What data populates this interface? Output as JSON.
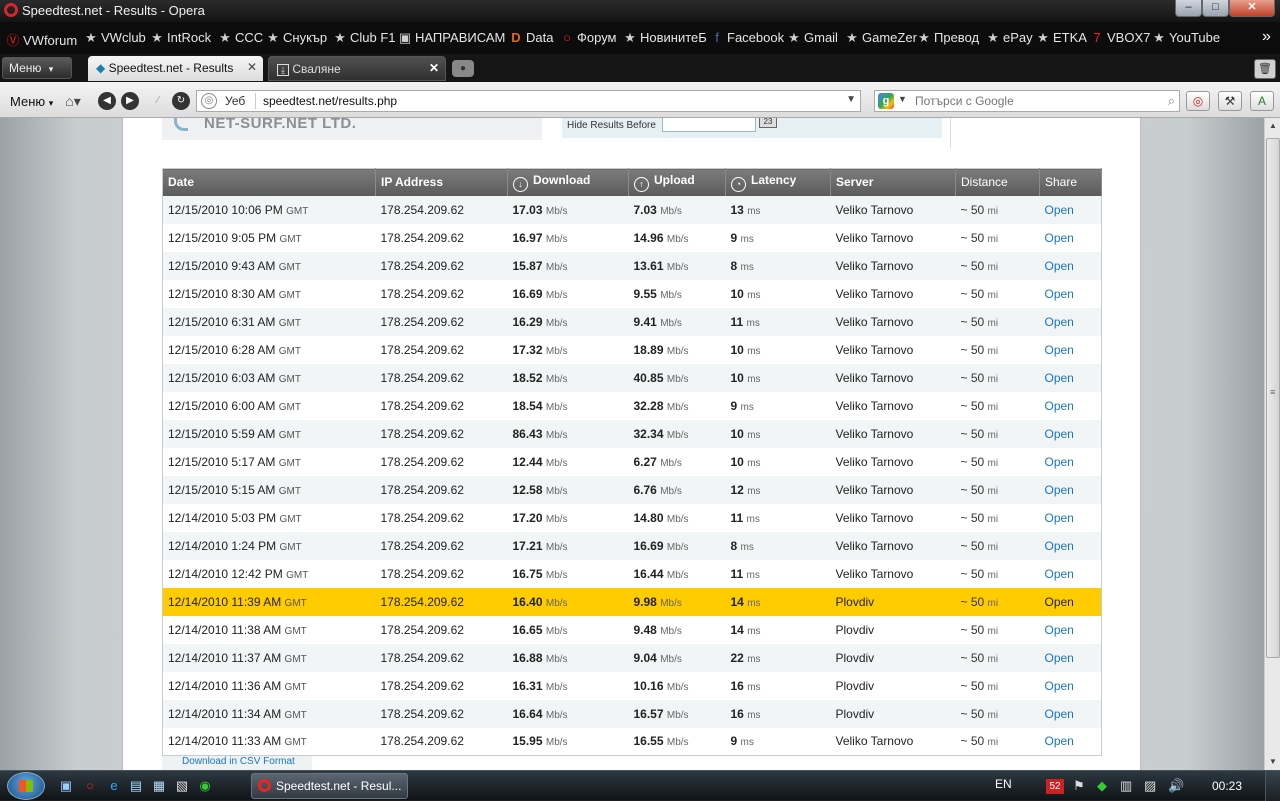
{
  "window": {
    "title": "Speedtest.net - Results - Opera",
    "minimize_icon": "minimize-icon",
    "maximize_icon": "maximize-icon",
    "close_icon": "close-icon"
  },
  "bookmarks": [
    {
      "label": "VWforum",
      "icon": "vw-icon"
    },
    {
      "label": "VWclub",
      "icon": "star-icon"
    },
    {
      "label": "IntRock",
      "icon": "star-icon"
    },
    {
      "label": "CCC",
      "icon": "star-icon"
    },
    {
      "label": "Снукър",
      "icon": "star-icon"
    },
    {
      "label": "Club F1",
      "icon": "star-icon"
    },
    {
      "label": "НАПРАВИСАМ",
      "icon": "page-icon"
    },
    {
      "label": "Data",
      "icon": "d-icon"
    },
    {
      "label": "Форум",
      "icon": "opera-icon"
    },
    {
      "label": "НовинитеБ",
      "icon": "star-icon"
    },
    {
      "label": "Facebook",
      "icon": "facebook-icon"
    },
    {
      "label": "Gmail",
      "icon": "star-icon"
    },
    {
      "label": "GameZer",
      "icon": "star-icon"
    },
    {
      "label": "Превод",
      "icon": "star-icon"
    },
    {
      "label": "ePay",
      "icon": "star-icon"
    },
    {
      "label": "ETKA",
      "icon": "star-icon"
    },
    {
      "label": "VBOX7",
      "icon": "vbox7-icon"
    },
    {
      "label": "YouTube",
      "icon": "star-icon"
    }
  ],
  "tabs": {
    "menu_label": "Меню",
    "items": [
      {
        "label": "Speedtest.net - Results",
        "active": true
      },
      {
        "label": "Сваляне",
        "active": false
      }
    ]
  },
  "navbar": {
    "menu_label": "Меню",
    "web_label": "Уеб",
    "address": "speedtest.net/results.php",
    "search_placeholder": "Потърси с Google"
  },
  "page": {
    "isp_name": "NET-SURF.NET LTD.",
    "hide_results_label": "Hide Results Before",
    "hide_results_value": "",
    "csv_link": "Download in CSV Format"
  },
  "table": {
    "headers": [
      "Date",
      "IP Address",
      "Download",
      "Upload",
      "Latency",
      "Server",
      "Distance",
      "Share"
    ],
    "units": {
      "speed": "Mb/s",
      "latency": "ms",
      "distance": "mi",
      "tz": "GMT",
      "distance_prefix": "~ 50"
    },
    "rows": [
      {
        "date": "12/15/2010 10:06 PM",
        "ip": "178.254.209.62",
        "down": "17.03",
        "up": "7.03",
        "lat": "13",
        "server": "Veliko Tarnovo",
        "share": "Open"
      },
      {
        "date": "12/15/2010 9:05 PM",
        "ip": "178.254.209.62",
        "down": "16.97",
        "up": "14.96",
        "lat": "9",
        "server": "Veliko Tarnovo",
        "share": "Open"
      },
      {
        "date": "12/15/2010 9:43 AM",
        "ip": "178.254.209.62",
        "down": "15.87",
        "up": "13.61",
        "lat": "8",
        "server": "Veliko Tarnovo",
        "share": "Open"
      },
      {
        "date": "12/15/2010 8:30 AM",
        "ip": "178.254.209.62",
        "down": "16.69",
        "up": "9.55",
        "lat": "10",
        "server": "Veliko Tarnovo",
        "share": "Open"
      },
      {
        "date": "12/15/2010 6:31 AM",
        "ip": "178.254.209.62",
        "down": "16.29",
        "up": "9.41",
        "lat": "11",
        "server": "Veliko Tarnovo",
        "share": "Open"
      },
      {
        "date": "12/15/2010 6:28 AM",
        "ip": "178.254.209.62",
        "down": "17.32",
        "up": "18.89",
        "lat": "10",
        "server": "Veliko Tarnovo",
        "share": "Open"
      },
      {
        "date": "12/15/2010 6:03 AM",
        "ip": "178.254.209.62",
        "down": "18.52",
        "up": "40.85",
        "lat": "10",
        "server": "Veliko Tarnovo",
        "share": "Open"
      },
      {
        "date": "12/15/2010 6:00 AM",
        "ip": "178.254.209.62",
        "down": "18.54",
        "up": "32.28",
        "lat": "9",
        "server": "Veliko Tarnovo",
        "share": "Open"
      },
      {
        "date": "12/15/2010 5:59 AM",
        "ip": "178.254.209.62",
        "down": "86.43",
        "up": "32.34",
        "lat": "10",
        "server": "Veliko Tarnovo",
        "share": "Open"
      },
      {
        "date": "12/15/2010 5:17 AM",
        "ip": "178.254.209.62",
        "down": "12.44",
        "up": "6.27",
        "lat": "10",
        "server": "Veliko Tarnovo",
        "share": "Open"
      },
      {
        "date": "12/15/2010 5:15 AM",
        "ip": "178.254.209.62",
        "down": "12.58",
        "up": "6.76",
        "lat": "12",
        "server": "Veliko Tarnovo",
        "share": "Open"
      },
      {
        "date": "12/14/2010 5:03 PM",
        "ip": "178.254.209.62",
        "down": "17.20",
        "up": "14.80",
        "lat": "11",
        "server": "Veliko Tarnovo",
        "share": "Open"
      },
      {
        "date": "12/14/2010 1:24 PM",
        "ip": "178.254.209.62",
        "down": "17.21",
        "up": "16.69",
        "lat": "8",
        "server": "Veliko Tarnovo",
        "share": "Open"
      },
      {
        "date": "12/14/2010 12:42 PM",
        "ip": "178.254.209.62",
        "down": "16.75",
        "up": "16.44",
        "lat": "11",
        "server": "Veliko Tarnovo",
        "share": "Open"
      },
      {
        "date": "12/14/2010 11:39 AM",
        "ip": "178.254.209.62",
        "down": "16.40",
        "up": "9.98",
        "lat": "14",
        "server": "Plovdiv",
        "share": "Open",
        "highlight": true
      },
      {
        "date": "12/14/2010 11:38 AM",
        "ip": "178.254.209.62",
        "down": "16.65",
        "up": "9.48",
        "lat": "14",
        "server": "Plovdiv",
        "share": "Open"
      },
      {
        "date": "12/14/2010 11:37 AM",
        "ip": "178.254.209.62",
        "down": "16.88",
        "up": "9.04",
        "lat": "22",
        "server": "Plovdiv",
        "share": "Open"
      },
      {
        "date": "12/14/2010 11:36 AM",
        "ip": "178.254.209.62",
        "down": "16.31",
        "up": "10.16",
        "lat": "16",
        "server": "Plovdiv",
        "share": "Open"
      },
      {
        "date": "12/14/2010 11:34 AM",
        "ip": "178.254.209.62",
        "down": "16.64",
        "up": "16.57",
        "lat": "16",
        "server": "Plovdiv",
        "share": "Open"
      },
      {
        "date": "12/14/2010 11:33 AM",
        "ip": "178.254.209.62",
        "down": "15.95",
        "up": "16.55",
        "lat": "9",
        "server": "Veliko Tarnovo",
        "share": "Open"
      }
    ]
  },
  "taskbar": {
    "active_window": "Speedtest.net - Resul...",
    "language": "EN",
    "tray_badge": "52",
    "clock": "00:23"
  },
  "colors": {
    "highlight_row": "#ffcc00",
    "link": "#1a76c2",
    "header_bg": "#6b6b6b"
  }
}
